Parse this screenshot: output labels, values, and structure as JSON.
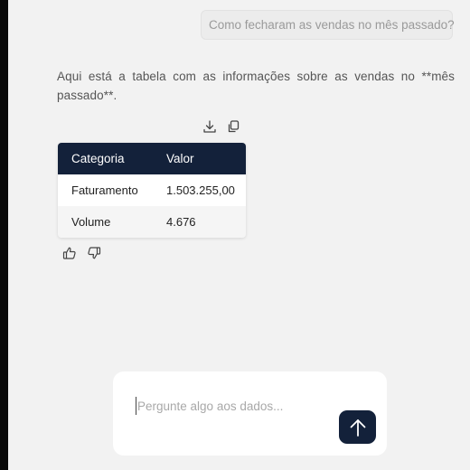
{
  "conversation": {
    "user_message": "Como fecharam as vendas no mês passado?",
    "assistant_message": "Aqui está a tabela com as informações sobre as vendas no **mês passado**."
  },
  "table": {
    "headers": [
      "Categoria",
      "Valor"
    ],
    "rows": [
      [
        "Faturamento",
        "1.503.255,00"
      ],
      [
        "Volume",
        "4.676"
      ]
    ]
  },
  "table_tools": {
    "icons": [
      "download-icon",
      "copy-icon"
    ]
  },
  "feedback": {
    "icons": [
      "thumbs-up-icon",
      "thumbs-down-icon"
    ]
  },
  "composer": {
    "placeholder": "Pergunte algo aos dados...",
    "value": "",
    "send_icon": "arrow-up-icon"
  },
  "colors": {
    "background": "#f2f2f2",
    "accent_dark": "#13213a",
    "user_bubble": "#ececec"
  }
}
